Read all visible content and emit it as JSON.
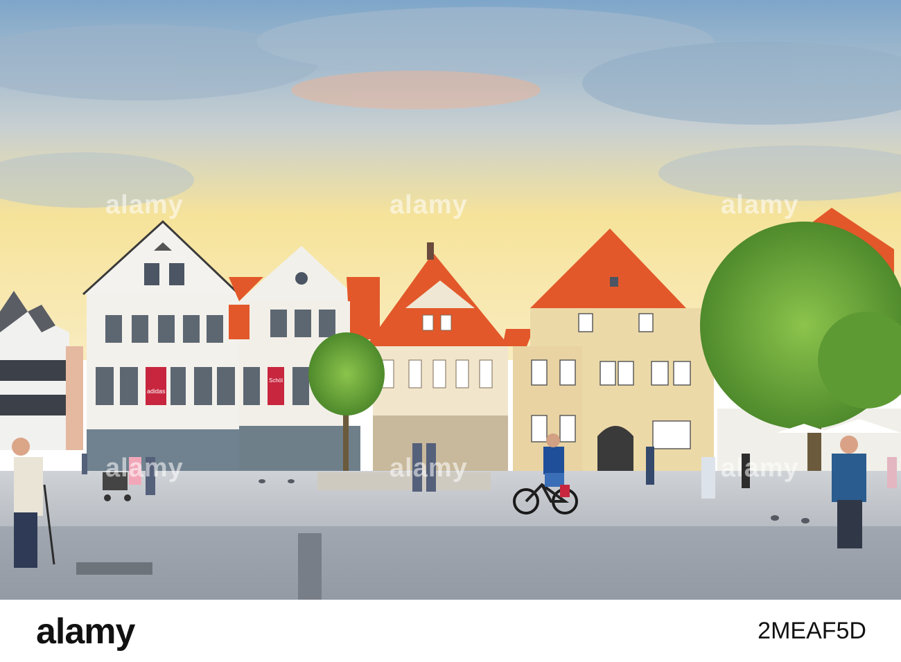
{
  "photo": {
    "subject": "Old town market square with gabled houses, tree, cyclist and pedestrians"
  },
  "storefront_signs": {
    "sign_left": "adidas",
    "sign_right": "Schöl"
  },
  "watermarks": [
    "alamy",
    "alamy",
    "alamy",
    "alamy",
    "alamy",
    "alamy"
  ],
  "footer": {
    "logo": "alamy",
    "image_id": "2MEAF5D"
  },
  "colors": {
    "roof": "#e2582a",
    "sky_top": "#8fb4d0",
    "sky_glow": "#f7e4a0",
    "pavement": "#b9bec6",
    "tree": "#6aa43a"
  }
}
